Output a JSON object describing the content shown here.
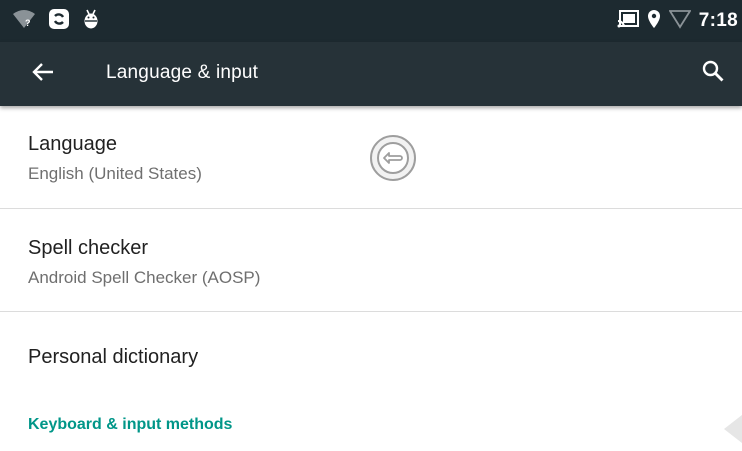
{
  "status_bar": {
    "time": "7:18",
    "left_icons": [
      "wifi-unknown-icon",
      "sync-icon",
      "android-debug-icon"
    ],
    "right_icons": [
      "cast-icon",
      "location-icon",
      "signal-icon"
    ]
  },
  "app_bar": {
    "title": "Language & input",
    "background_color": "#263238",
    "back_icon": "arrow-back-icon",
    "search_icon": "search-icon"
  },
  "preferences": [
    {
      "title": "Language",
      "summary": "English (United States)"
    },
    {
      "title": "Spell checker",
      "summary": "Android Spell Checker (AOSP)"
    },
    {
      "title": "Personal dictionary",
      "summary": ""
    }
  ],
  "category": {
    "label": "Keyboard & input methods",
    "color": "#009688"
  },
  "overlay": {
    "touch_indicator_icon": "touch-pointer-icon"
  }
}
